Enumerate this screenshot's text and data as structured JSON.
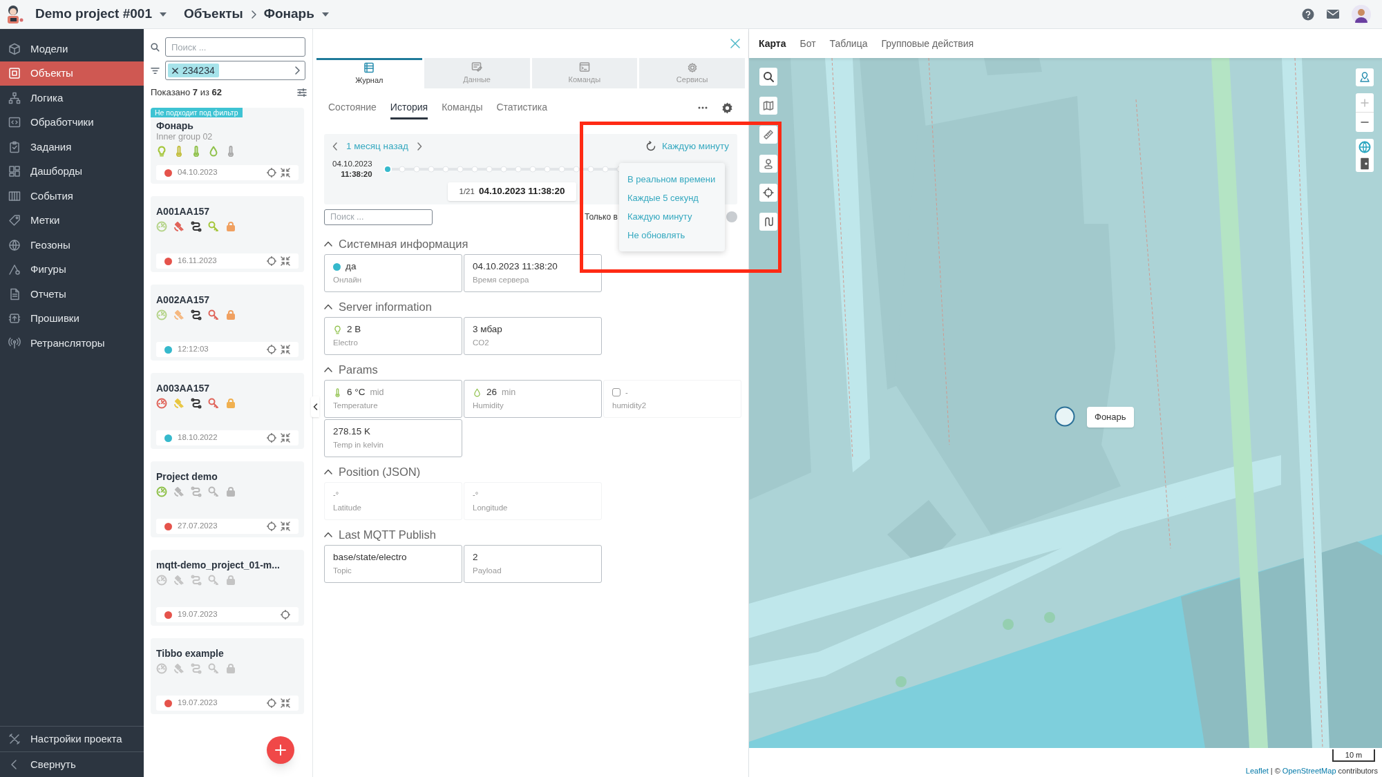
{
  "header": {
    "project": "Demo project #001",
    "breadcrumbs": [
      "Объекты",
      "Фонарь"
    ]
  },
  "sidebar": {
    "items": [
      {
        "label": "Модели",
        "selected": false
      },
      {
        "label": "Объекты",
        "selected": true
      },
      {
        "label": "Логика",
        "selected": false
      },
      {
        "label": "Обработчики",
        "selected": false
      },
      {
        "label": "Задания",
        "selected": false
      },
      {
        "label": "Дашборды",
        "selected": false
      },
      {
        "label": "События",
        "selected": false
      },
      {
        "label": "Метки",
        "selected": false
      },
      {
        "label": "Геозоны",
        "selected": false
      },
      {
        "label": "Фигуры",
        "selected": false
      },
      {
        "label": "Отчеты",
        "selected": false
      },
      {
        "label": "Прошивки",
        "selected": false
      },
      {
        "label": "Ретрансляторы",
        "selected": false
      }
    ],
    "footer": [
      "Настройки проекта",
      "Свернуть"
    ]
  },
  "object_list": {
    "search": {
      "placeholder": "Поиск ..."
    },
    "filter_tag": "234234",
    "summary": "Показано **7** из **62**",
    "objects": [
      {
        "badge": "Не подходит под фильтр",
        "name": "Фонарь",
        "subtitle": "Inner group 02",
        "sensors": [
          {
            "kind": "bulb",
            "color": "#a4c63a"
          },
          {
            "kind": "thermometer",
            "color": "#c2bd3a"
          },
          {
            "kind": "thermometer",
            "color": "#8fc14a"
          },
          {
            "kind": "drop",
            "color": "#8fc14a"
          },
          {
            "kind": "thermometer",
            "color": "#a8a8a8"
          }
        ],
        "color": "#e5534b",
        "date": "04.10.2023",
        "collapse": true
      },
      {
        "name": "A001AA157",
        "sensors": [
          {
            "kind": "gauge",
            "color": "#b5d48a"
          },
          {
            "kind": "satellite",
            "color": "#e0645a"
          },
          {
            "kind": "route",
            "color": "#333333"
          },
          {
            "kind": "key",
            "color": "#a4c63a"
          },
          {
            "kind": "lock",
            "color": "#f0a060"
          }
        ],
        "color": "#e5534b",
        "date": "16.11.2023",
        "collapse": true
      },
      {
        "name": "A002AA157",
        "sensors": [
          {
            "kind": "gauge",
            "color": "#b5d48a"
          },
          {
            "kind": "satellite",
            "color": "#f5b880"
          },
          {
            "kind": "route",
            "color": "#333333"
          },
          {
            "kind": "key",
            "color": "#e0645a"
          },
          {
            "kind": "lock",
            "color": "#f0a060"
          }
        ],
        "color": "#36b9cc",
        "date": "12:12:03",
        "collapse": true
      },
      {
        "name": "A003AA157",
        "sensors": [
          {
            "kind": "gauge",
            "color": "#e0645a"
          },
          {
            "kind": "satellite",
            "color": "#e8c640"
          },
          {
            "kind": "route",
            "color": "#333333"
          },
          {
            "kind": "key",
            "color": "#e0645a"
          },
          {
            "kind": "lock",
            "color": "#f0b050"
          }
        ],
        "color": "#36b9cc",
        "date": "18.10.2022",
        "collapse": true
      },
      {
        "name": "Project demo",
        "sensors": [
          {
            "kind": "gauge",
            "color": "#8fc14a"
          },
          {
            "kind": "satellite",
            "color": "#b8b8b8"
          },
          {
            "kind": "route",
            "color": "#b8b8b8"
          },
          {
            "kind": "key",
            "color": "#b8b8b8"
          },
          {
            "kind": "lock",
            "color": "#b8b8b8"
          }
        ],
        "color": "#e5534b",
        "date": "27.07.2023",
        "collapse": true
      },
      {
        "name": "mqtt-demo_project_01-m...",
        "sensors": [
          {
            "kind": "gauge",
            "color": "#c4c4c4"
          },
          {
            "kind": "satellite",
            "color": "#c4c4c4"
          },
          {
            "kind": "route",
            "color": "#c4c4c4"
          },
          {
            "kind": "key",
            "color": "#c4c4c4"
          },
          {
            "kind": "lock",
            "color": "#c4c4c4"
          }
        ],
        "color": "#e5534b",
        "date": "19.07.2023",
        "collapse": false
      },
      {
        "name": "Tibbo example",
        "sensors": [
          {
            "kind": "gauge",
            "color": "#c4c4c4"
          },
          {
            "kind": "satellite",
            "color": "#c4c4c4"
          },
          {
            "kind": "route",
            "color": "#c4c4c4"
          },
          {
            "kind": "key",
            "color": "#c4c4c4"
          },
          {
            "kind": "lock",
            "color": "#c4c4c4"
          }
        ],
        "color": "#e5534b",
        "date": "19.07.2023",
        "collapse": true
      }
    ]
  },
  "details": {
    "tabs": [
      {
        "label": "Журнал",
        "selected": true
      },
      {
        "label": "Данные",
        "selected": false
      },
      {
        "label": "Команды",
        "selected": false
      },
      {
        "label": "Сервисы",
        "selected": false
      }
    ],
    "subtabs": [
      {
        "label": "Состояние",
        "selected": false
      },
      {
        "label": "История",
        "selected": true
      },
      {
        "label": "Команды",
        "selected": false
      },
      {
        "label": "Статистика",
        "selected": false
      }
    ],
    "timeline": {
      "period": "1 месяц назад",
      "refresh": "Каждую минуту",
      "start_date": "04.10.2023",
      "start_time": "11:38:20",
      "counter": "1/21",
      "current": "04.10.2023 11:38:20"
    },
    "search": {
      "placeholder": "Поиск ..."
    },
    "only_filter": {
      "label": "Только в",
      "on": false
    },
    "refresh_menu": [
      "В реальном времени",
      "Каждые 5 секунд",
      "Каждую минуту",
      "Не обновлять"
    ],
    "sections": [
      {
        "title": "Системная информация",
        "expanded": true,
        "fields": [
          {
            "kind": "dot",
            "color": "#36b9cc",
            "value": "да",
            "label": "Онлайн"
          },
          {
            "kind": "plain",
            "value": "04.10.2023 11:38:20",
            "label": "Время сервера"
          }
        ]
      },
      {
        "title": "Server information",
        "expanded": true,
        "fields": [
          {
            "kind": "bulb",
            "value": "2 В",
            "label": "Electro"
          },
          {
            "kind": "plain",
            "value": "3 мбар",
            "label": "CO2"
          }
        ]
      },
      {
        "title": "Params",
        "expanded": true,
        "fields": [
          {
            "kind": "thermometer",
            "value": "6 °C",
            "unit": "mid",
            "label": "Temperature"
          },
          {
            "kind": "drop",
            "value": "26",
            "unit": "min",
            "label": "Humidity"
          },
          {
            "kind": "checkbox",
            "checked": false,
            "value": "-",
            "label": "humidity2"
          },
          {
            "kind": "plain",
            "value": "278.15 K",
            "label": "Temp in kelvin"
          }
        ]
      },
      {
        "title": "Position (JSON)",
        "expanded": true,
        "fields": [
          {
            "kind": "empty",
            "value": "-°",
            "label": "Latitude"
          },
          {
            "kind": "empty",
            "value": "-°",
            "label": "Longitude"
          }
        ]
      },
      {
        "title": "Last MQTT Publish",
        "expanded": true,
        "fields": [
          {
            "kind": "plain",
            "value": "base/state/electro",
            "label": "Topic"
          },
          {
            "kind": "plain",
            "value": "2",
            "label": "Payload"
          }
        ]
      }
    ]
  },
  "map": {
    "tabs": [
      {
        "label": "Карта",
        "selected": true
      },
      {
        "label": "Бот",
        "selected": false
      },
      {
        "label": "Таблица",
        "selected": false
      },
      {
        "label": "Групповые действия",
        "selected": false
      }
    ],
    "marker_label": "Фонарь",
    "scale": "10 m",
    "attribution": {
      "leaflet": "Leaflet",
      "separator": "| ©",
      "osm": "OpenStreetMap",
      "suffix": "contributors"
    }
  }
}
